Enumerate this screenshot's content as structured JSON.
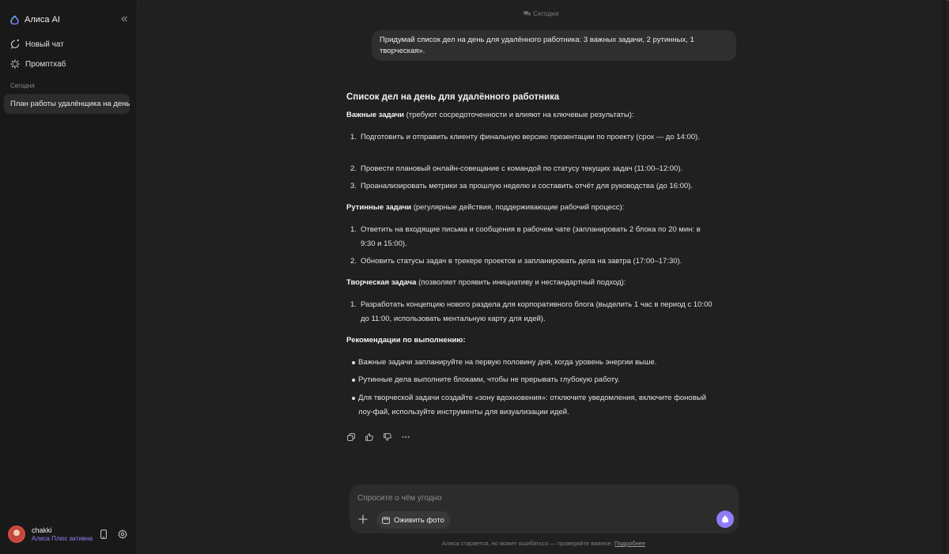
{
  "app": {
    "title": "Алиса AI"
  },
  "colors": {
    "accent": "#8f7cf6",
    "plan": "#9b7cf5",
    "sidebar_bg": "#191919",
    "main_bg": "#202020"
  },
  "sidebar": {
    "new_chat": "Новый чат",
    "prompthub": "Промптхаб",
    "section_today": "Сегодня",
    "chats": [
      "План работы удалёнщика на день"
    ],
    "icons": {
      "collapse": "double-chevron-left-icon",
      "new_chat": "new-chat-icon",
      "prompthub": "sparkle-icon"
    }
  },
  "user": {
    "name": "chakki",
    "plan": "Алиса Плюс активна",
    "icons": {
      "phone": "phone-icon",
      "settings": "gear-icon"
    }
  },
  "conversation": {
    "date_label": "Сегодня",
    "user_message": "Придумай список дел на день для удалённого работника: 3 важных задачи, 2 рутинных, 1 творческая».",
    "answer": {
      "title": "Список дел на день для удалённого работника",
      "important": {
        "heading": "Важные задачи",
        "note": " (требуют сосредоточенности и влияют на ключевые результаты):",
        "items": [
          "Подготовить и отправить клиенту финальную версию презентации по проекту (срок — до 14:00).",
          "Провести плановый онлайн‑совещание с командой по статусу текущих задач (11:00–12:00).",
          "Проанализировать метрики за прошлую неделю и составить отчёт для руководства (до 16:00)."
        ]
      },
      "routine": {
        "heading": "Рутинные задачи",
        "note": " (регулярные действия, поддерживающие рабочий процесс):",
        "items": [
          "Ответить на входящие письма и сообщения в рабочем чате (запланировать 2 блока по 20 мин: в 9:30 и 15:00).",
          "Обновить статусы задач в трекере проектов и запланировать дела на завтра (17:00–17:30)."
        ]
      },
      "creative": {
        "heading": "Творческая задача",
        "note": " (позволяет проявить инициативу и нестандартный подход):",
        "items": [
          "Разработать концепцию нового раздела для корпоративного блога (выделить 1 час в период с 10:00 до 11:00, использовать ментальную карту для идей)."
        ]
      },
      "tips": {
        "heading": "Рекомендации по выполнению:",
        "items": [
          "Важные задачи запланируйте на первую половину дня, когда уровень энергии выше.",
          "Рутинные дела выполните блоками, чтобы не прерывать глубокую работу.",
          "Для творческой задачи создайте «зону вдохновения»: отключите уведомления, включите фоновый лоу‑фай, используйте инструменты для визуализации идей."
        ]
      }
    },
    "actions": [
      "copy-icon",
      "thumbs-up-icon",
      "thumbs-down-icon",
      "more-icon"
    ]
  },
  "composer": {
    "placeholder": "Спросите о чём угодно",
    "photo_button": "Оживить фото"
  },
  "footer": {
    "disclaimer": "Алиса старается, но может ошибаться — проверяйте важное.",
    "link": "Подробнее"
  }
}
